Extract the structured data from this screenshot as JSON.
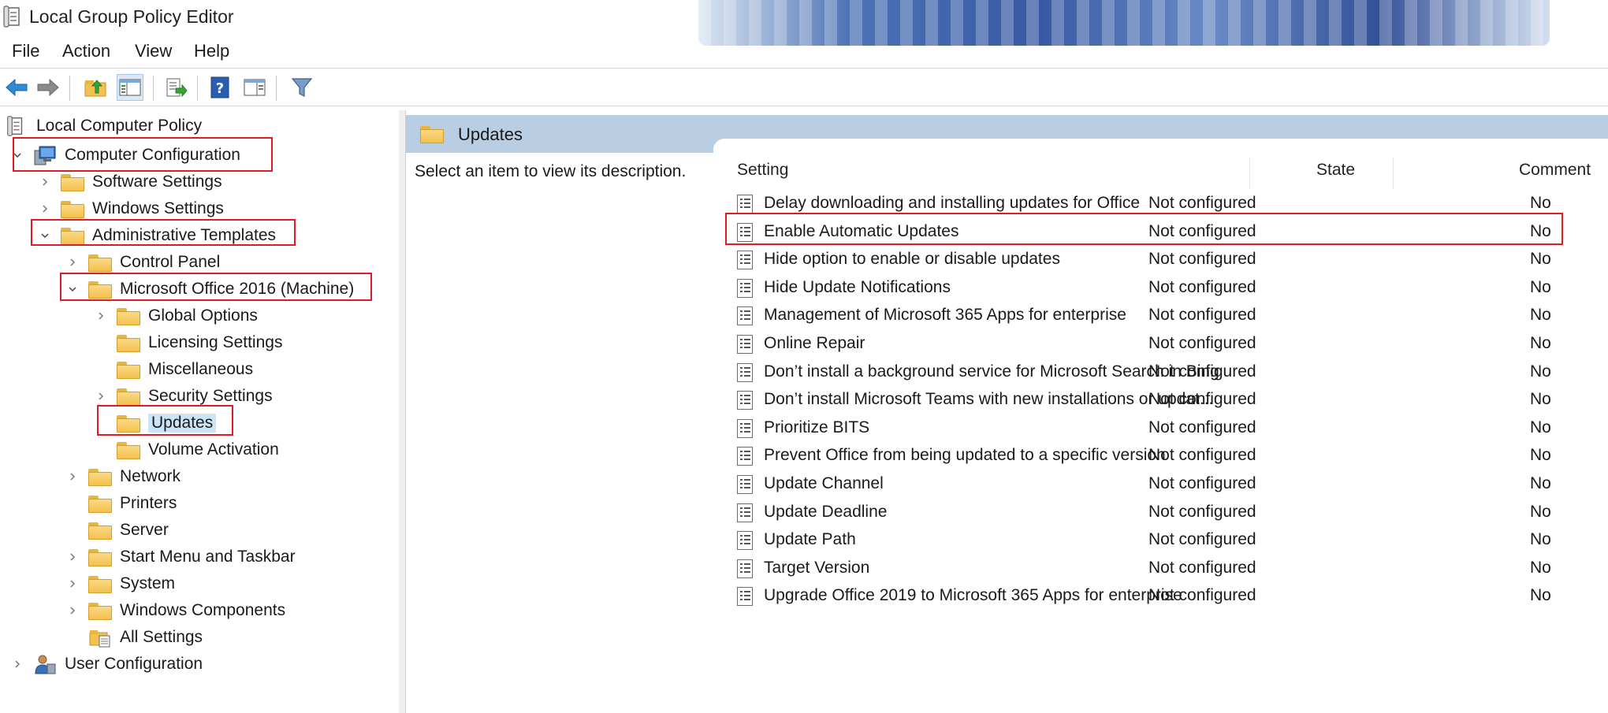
{
  "window": {
    "title": "Local Group Policy Editor"
  },
  "menu": [
    "File",
    "Action",
    "View",
    "Help"
  ],
  "toolbar": {
    "icons": [
      "back-arrow-icon",
      "forward-arrow-icon",
      "up-folder-icon",
      "show-hide-tree-icon",
      "export-list-icon",
      "help-icon",
      "show-hide-action-pane-icon",
      "filter-icon"
    ]
  },
  "tree": {
    "root": "Local Computer Policy",
    "computer_config": "Computer Configuration",
    "software_settings": "Software Settings",
    "windows_settings": "Windows Settings",
    "admin_templates": "Administrative Templates",
    "control_panel": "Control Panel",
    "office2016": "Microsoft Office 2016 (Machine)",
    "global_options": "Global Options",
    "licensing_settings": "Licensing Settings",
    "miscellaneous": "Miscellaneous",
    "security_settings": "Security Settings",
    "updates": "Updates",
    "volume_activation": "Volume Activation",
    "network": "Network",
    "printers": "Printers",
    "server": "Server",
    "start_menu": "Start Menu and Taskbar",
    "system": "System",
    "windows_components": "Windows Components",
    "all_settings": "All Settings",
    "user_config": "User Configuration"
  },
  "right": {
    "header_title": "Updates",
    "description": "Select an item to view its description.",
    "columns": {
      "setting": "Setting",
      "state": "State",
      "comment": "Comment"
    },
    "rows": [
      {
        "setting": "Delay downloading and installing updates for Office",
        "state": "Not configured",
        "comment": "No"
      },
      {
        "setting": "Enable Automatic Updates",
        "state": "Not configured",
        "comment": "No"
      },
      {
        "setting": "Hide option to enable or disable updates",
        "state": "Not configured",
        "comment": "No"
      },
      {
        "setting": "Hide Update Notifications",
        "state": "Not configured",
        "comment": "No"
      },
      {
        "setting": "Management of Microsoft 365 Apps for enterprise",
        "state": "Not configured",
        "comment": "No"
      },
      {
        "setting": "Online Repair",
        "state": "Not configured",
        "comment": "No"
      },
      {
        "setting": "Don’t install a background service for Microsoft Search in Bing",
        "state": "Not configured",
        "comment": "No"
      },
      {
        "setting": "Don’t install Microsoft Teams with new installations or updat...",
        "state": "Not configured",
        "comment": "No"
      },
      {
        "setting": "Prioritize BITS",
        "state": "Not configured",
        "comment": "No"
      },
      {
        "setting": "Prevent Office from being updated to a specific version",
        "state": "Not configured",
        "comment": "No"
      },
      {
        "setting": "Update Channel",
        "state": "Not configured",
        "comment": "No"
      },
      {
        "setting": "Update Deadline",
        "state": "Not configured",
        "comment": "No"
      },
      {
        "setting": "Update Path",
        "state": "Not configured",
        "comment": "No"
      },
      {
        "setting": "Target Version",
        "state": "Not configured",
        "comment": "No"
      },
      {
        "setting": "Upgrade Office 2019 to Microsoft 365 Apps for enterprise",
        "state": "Not configured",
        "comment": "No"
      }
    ]
  },
  "colors": {
    "annotation": "#e01b24",
    "header_band": "#b9cde3",
    "selection": "#cce4f7"
  }
}
